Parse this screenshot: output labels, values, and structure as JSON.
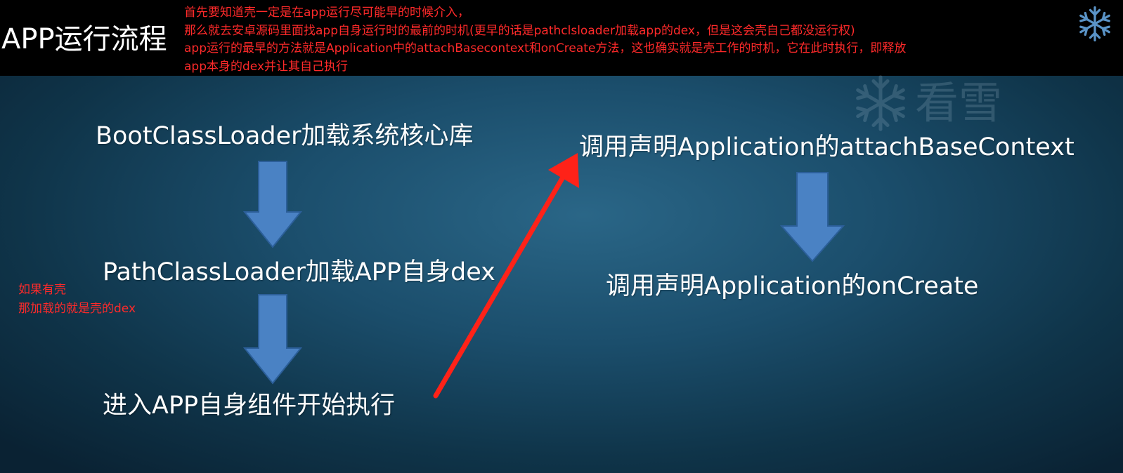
{
  "header": {
    "title": "APP运行流程",
    "notes": [
      "首先要知道壳一定是在app运行尽可能早的时候介入，",
      "那么就去安卓源码里面找app自身运行时的最前的时机(更早的话是pathclsloader加载app的dex，但是这会壳自己都没运行权)",
      "app运行的最早的方法就是Application中的attachBasecontext和onCreate方法，这也确实就是壳工作的时机，它在此时执行，即释放",
      "app本身的dex并让其自己执行"
    ]
  },
  "watermark": {
    "text": "看雪",
    "icon": "snowflake-icon"
  },
  "flow_left": {
    "step1": "BootClassLoader加载系统核心库",
    "step2": "PathClassLoader加载APP自身dex",
    "step3": "进入APP自身组件开始执行"
  },
  "flow_right": {
    "step1": "调用声明Application的attachBaseContext",
    "step2": "调用声明Application的onCreate"
  },
  "side_note": {
    "line1": "如果有壳",
    "line2": "那加载的就是壳的dex"
  },
  "colors": {
    "annotation": "#ff2a2a",
    "arrow_fill": "#4a82c4",
    "background": "#1b4e6c"
  }
}
